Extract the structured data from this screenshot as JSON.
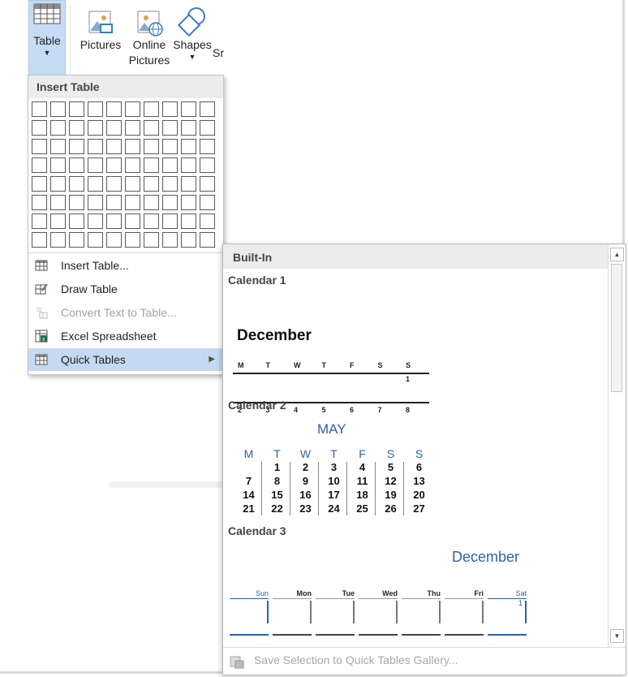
{
  "ribbon": {
    "table": {
      "label": "Table"
    },
    "pictures": {
      "label": "Pictures"
    },
    "online_pictures": {
      "label_line1": "Online",
      "label_line2": "Pictures"
    },
    "shapes": {
      "label": "Shapes"
    },
    "smartart": {
      "label_partial": "Sr"
    }
  },
  "insert_menu": {
    "header": "Insert Table",
    "grid": {
      "cols": 10,
      "rows": 8
    },
    "items": [
      {
        "label": "Insert Table...",
        "icon": "insert-table-icon",
        "enabled": true
      },
      {
        "label": "Draw Table",
        "icon": "draw-table-icon",
        "enabled": true
      },
      {
        "label": "Convert Text to Table...",
        "icon": "convert-text-icon",
        "enabled": false
      },
      {
        "label": "Excel Spreadsheet",
        "icon": "excel-icon",
        "enabled": true
      },
      {
        "label": "Quick Tables",
        "icon": "quick-tables-icon",
        "enabled": true,
        "highlighted": true
      }
    ]
  },
  "gallery": {
    "header": "Built-In",
    "calendar1": {
      "title": "Calendar 1",
      "month": "December",
      "days": [
        "M",
        "T",
        "W",
        "T",
        "F",
        "S",
        "S"
      ],
      "row1": [
        "",
        "",
        "",
        "",
        "",
        "",
        "1"
      ],
      "row2": [
        "2",
        "3",
        "4",
        "5",
        "6",
        "7",
        "8"
      ]
    },
    "calendar2": {
      "title": "Calendar 2",
      "month": "MAY",
      "days": [
        "M",
        "T",
        "W",
        "T",
        "F",
        "S",
        "S"
      ],
      "weeks": [
        [
          "",
          "1",
          "2",
          "3",
          "4",
          "5",
          "6"
        ],
        [
          "7",
          "8",
          "9",
          "10",
          "11",
          "12",
          "13"
        ],
        [
          "14",
          "15",
          "16",
          "17",
          "18",
          "19",
          "20"
        ],
        [
          "21",
          "22",
          "23",
          "24",
          "25",
          "26",
          "27"
        ]
      ]
    },
    "calendar3": {
      "title": "Calendar 3",
      "month": "December",
      "days": [
        "Sun",
        "Mon",
        "Tue",
        "Wed",
        "Thu",
        "Fri",
        "Sat"
      ],
      "first_day": "1"
    },
    "footer": "Save Selection to Quick Tables Gallery..."
  }
}
